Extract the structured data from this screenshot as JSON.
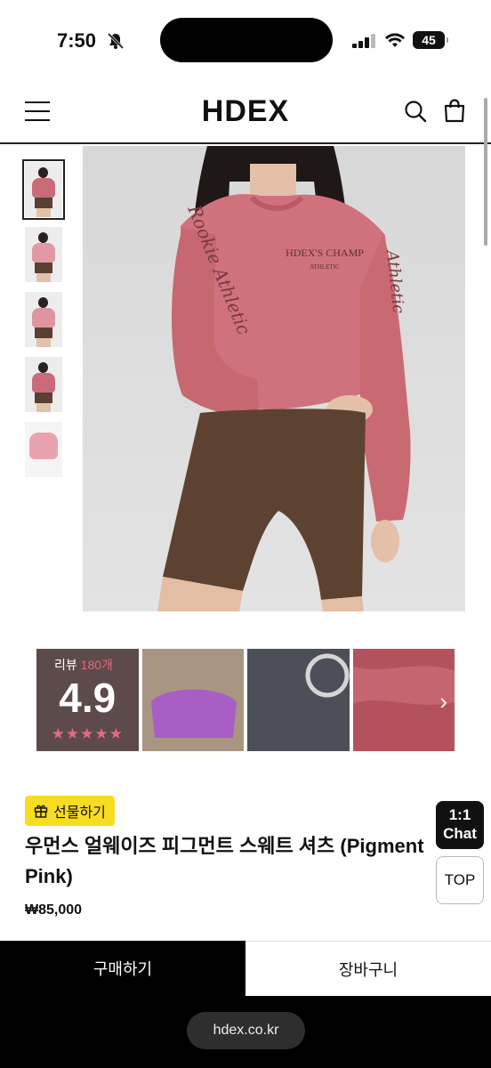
{
  "status_bar": {
    "time": "7:50",
    "battery": "45"
  },
  "header": {
    "logo": "HDEX"
  },
  "gallery": {
    "thumbnail_count": 5
  },
  "reviews": {
    "label": "리뷰",
    "count": "180개",
    "score": "4.9",
    "stars": "★★★★★"
  },
  "product": {
    "gift_label": "선물하기",
    "name": "우먼스 얼웨이즈 피그먼트 스웨트 셔츠 (Pigment Pink)",
    "price": "₩85,000"
  },
  "floating": {
    "chat_line1": "1:1",
    "chat_line2": "Chat",
    "top": "TOP"
  },
  "actions": {
    "buy": "구매하기",
    "cart": "장바구니"
  },
  "browser": {
    "url": "hdex.co.kr"
  },
  "colors": {
    "accent_pink": "#e46a7f",
    "gift_yellow": "#f7dd21",
    "product_pink": "#d0727e"
  }
}
